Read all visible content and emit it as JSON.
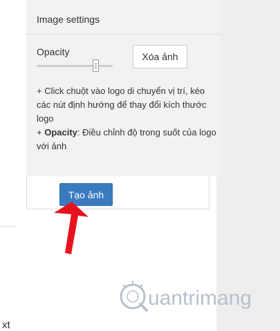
{
  "panel": {
    "title": "Image settings",
    "opacity_label": "Opacity",
    "opacity_level_fraction": 0.8,
    "delete_image_label": "Xóa ảnh",
    "instructions": {
      "line1": "+ Click chuột vào logo di chuyển vị trí, kéo các nút định hướng để thay đổi kích thước logo",
      "line2_prefix": "+ ",
      "line2_bold": "Opacity",
      "line2_rest": ": Điều chỉnh độ trong suốt của logo với ảnh"
    }
  },
  "create_image_label": "Tạo ảnh",
  "page_text_fragment": "xt",
  "watermark": {
    "text": "uantrimang",
    "icon": "lightbulb-q-logo-icon"
  },
  "colors": {
    "primary_button": "#3a7bbf",
    "arrow": "#e8121e",
    "panel_bg": "#f2f2f2",
    "watermark": "#b8c0cc"
  }
}
